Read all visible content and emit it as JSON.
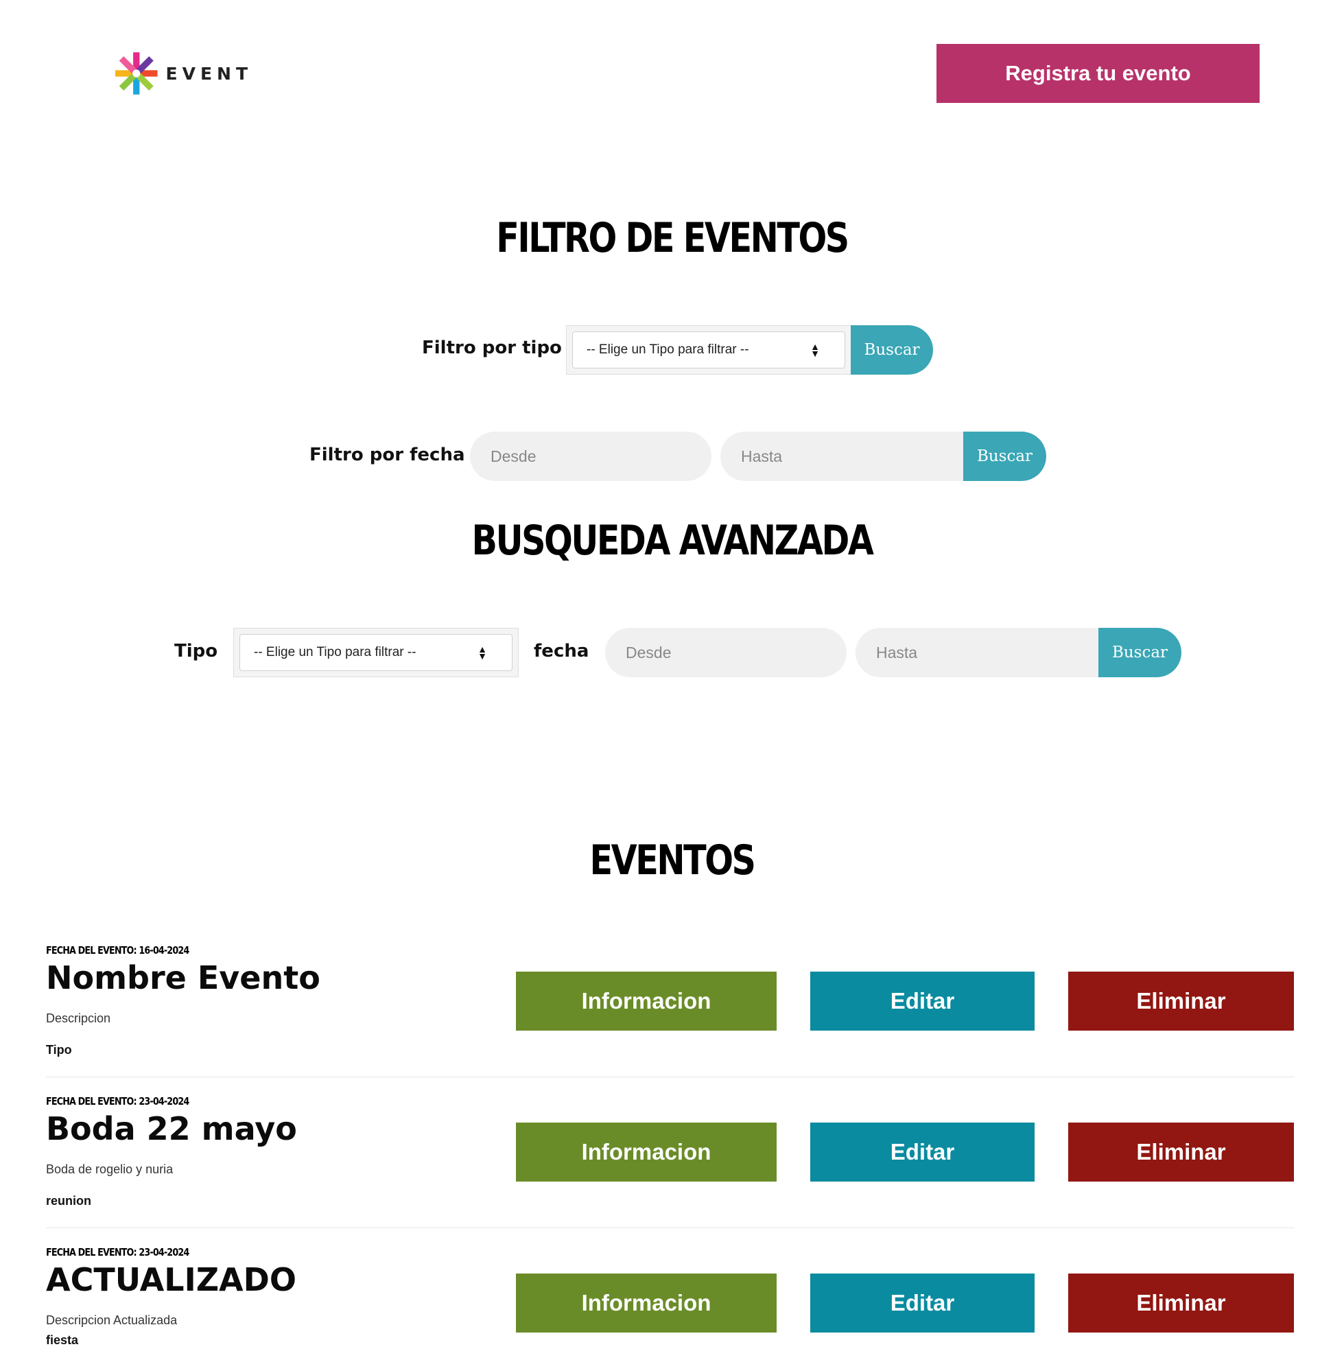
{
  "header": {
    "logo_text": "EVENT",
    "register_label": "Registra tu evento"
  },
  "filters": {
    "title": "FILTRO DE EVENTOS",
    "by_type_label": "Filtro por tipo",
    "type_select_value": "-- Elige un Tipo para filtrar --",
    "by_type_button": "Buscar",
    "by_date_label": "Filtro por fecha",
    "date_from_placeholder": "Desde",
    "date_to_placeholder": "Hasta",
    "by_date_button": "Buscar"
  },
  "advanced": {
    "title": "BUSQUEDA AVANZADA",
    "type_label": "Tipo",
    "type_select_value": "-- Elige un Tipo para filtrar --",
    "date_label": "fecha",
    "date_from_placeholder": "Desde",
    "date_to_placeholder": "Hasta",
    "button": "Buscar"
  },
  "events": {
    "title": "EVENTOS",
    "items": [
      {
        "date": "FECHA DEL EVENTO: 16-04-2024",
        "name": "Nombre Evento",
        "description": "Descripcion",
        "type": "Tipo"
      },
      {
        "date": "FECHA DEL EVENTO: 23-04-2024",
        "name": "Boda 22 mayo",
        "description": "Boda de rogelio y nuria",
        "type": "reunion"
      },
      {
        "date": "FECHA DEL EVENTO: 23-04-2024",
        "name": "ACTUALIZADO",
        "description": "Descripcion Actualizada",
        "type": "fiesta"
      }
    ],
    "info_label": "Informacion",
    "edit_label": "Editar",
    "delete_label": "Eliminar"
  },
  "colors": {
    "brand": "#b8326a",
    "buscar": "#3aa6b6",
    "info": "#6a8c28",
    "edit": "#0a8ba0",
    "delete": "#921611"
  }
}
